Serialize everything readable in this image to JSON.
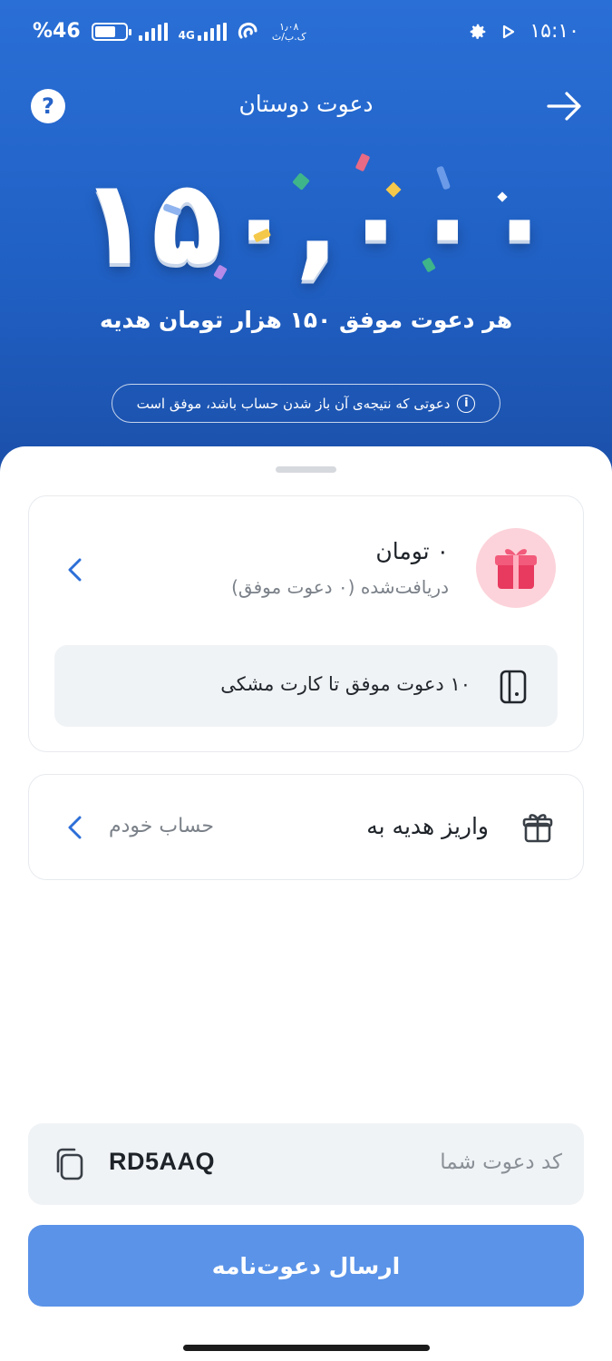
{
  "status_bar": {
    "battery_percent": "46",
    "percent_sign": "%",
    "network": "4G",
    "speed": "۱٫۰۸",
    "speed_unit": "ک.ب/ث",
    "time": "۱۵:۱۰"
  },
  "header": {
    "title": "دعوت دوستان",
    "help_label": "?"
  },
  "banner": {
    "amount_art": "۱۵۰,۰۰۰",
    "tagline": "هر دعوت موفق ۱۵۰ هزار تومان هدیه",
    "info_text": "دعوتی که نتیجه‌ی آن باز شدن حساب باشد، موفق است",
    "info_icon": "i"
  },
  "earnings_card": {
    "amount": "۰ تومان",
    "subtitle": "دریافت‌شده (۰ دعوت موفق)",
    "progress_text": "۱۰ دعوت موفق تا کارت مشکی"
  },
  "deposit_card": {
    "label": "واریز هدیه به",
    "value": "حساب خودم"
  },
  "invite_code": {
    "label": "کد دعوت شما",
    "code": "RD5AAQ"
  },
  "send_button": {
    "label": "ارسال دعوت‌نامه"
  },
  "colors": {
    "header_blue": "#2563c8",
    "button_blue": "#5a93e8",
    "gift_pink": "#fcd3da"
  }
}
